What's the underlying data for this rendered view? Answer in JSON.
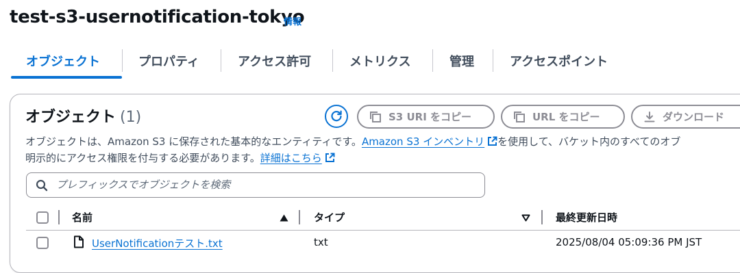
{
  "header": {
    "title": "test-s3-usernotification-tokyo",
    "info_label": "情報"
  },
  "tabs": [
    {
      "label": "オブジェクト",
      "active": true
    },
    {
      "label": "プロパティ",
      "active": false
    },
    {
      "label": "アクセス許可",
      "active": false
    },
    {
      "label": "メトリクス",
      "active": false
    },
    {
      "label": "管理",
      "active": false
    },
    {
      "label": "アクセスポイント",
      "active": false
    }
  ],
  "panel": {
    "title": "オブジェクト",
    "count": "(1)",
    "buttons": {
      "copy_s3_uri": "S3 URI をコピー",
      "copy_url": "URL をコピー",
      "download": "ダウンロード"
    },
    "description": {
      "part1": "オブジェクトは、Amazon S3 に保存された基本的なエンティティです。",
      "inventory_link": "Amazon S3 インベントリ",
      "part2": "を使用して、バケット内のすべてのオブ",
      "line2": "明示的にアクセス権限を付与する必要があります。",
      "details_link": "詳細はこちら"
    },
    "search": {
      "placeholder": "プレフィックスでオブジェクトを検索",
      "value": ""
    },
    "table": {
      "columns": {
        "name": "名前",
        "type": "タイプ",
        "last_modified": "最終更新日時"
      },
      "rows": [
        {
          "name": "UserNotificationテスト.txt",
          "type": "txt",
          "last_modified": "2025/08/04 05:09:36 PM JST"
        }
      ]
    }
  },
  "colors": {
    "accent": "#0972d3",
    "text": "#0f141a",
    "muted": "#8c8c94"
  }
}
